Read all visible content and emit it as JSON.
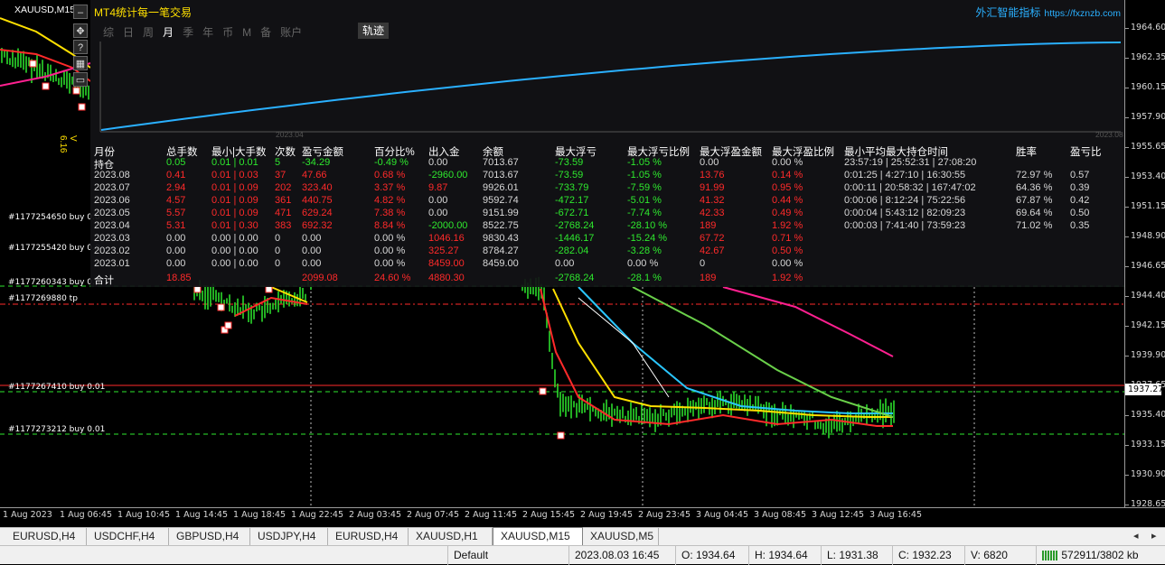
{
  "symbol_label": "XAUUSD,M15",
  "indicator_label": "V 6.16",
  "panel": {
    "title": "MT4统计每一笔交易",
    "brand": "外汇智能指标",
    "brand_url": "https://fxznzb.com",
    "periods": [
      "综",
      "日",
      "周",
      "月",
      "季",
      "年",
      "币",
      "M",
      "备",
      "账户"
    ],
    "active_period": "月",
    "traj_button": "轨迹",
    "mini_chart": {
      "x_start_label": "2023.04",
      "x_end_label": "2023.08"
    },
    "headers": [
      "月份",
      "总手数",
      "最小|大手数",
      "次数",
      "盈亏金额",
      "百分比%",
      "出入金",
      "余额",
      "最大浮亏",
      "最大浮亏比例",
      "最大浮盈金额",
      "最大浮盈比例",
      "最小平均最大持仓时间",
      "胜率",
      "盈亏比"
    ],
    "position_row": [
      "持仓",
      "0.05",
      "0.01 | 0.01",
      "5",
      "-34.29",
      "-0.49 %",
      "0.00",
      "7013.67",
      "-73.59",
      "-1.05 %",
      "0.00",
      "0.00 %",
      "23:57:19 | 25:52:31 | 27:08:20",
      "",
      ""
    ],
    "rows": [
      [
        "2023.08",
        "0.41",
        "0.01 | 0.03",
        "37",
        "47.66",
        "0.68 %",
        "-2960.00",
        "7013.67",
        "-73.59",
        "-1.05 %",
        "13.76",
        "0.14 %",
        "0:01:25 | 4:27:10 | 16:30:55",
        "72.97 %",
        "0.57"
      ],
      [
        "2023.07",
        "2.94",
        "0.01 | 0.09",
        "202",
        "323.40",
        "3.37 %",
        "9.87",
        "9926.01",
        "-733.79",
        "-7.59 %",
        "91.99",
        "0.95 %",
        "0:00:11 | 20:58:32 | 167:47:02",
        "64.36 %",
        "0.39"
      ],
      [
        "2023.06",
        "4.57",
        "0.01 | 0.09",
        "361",
        "440.75",
        "4.82 %",
        "0.00",
        "9592.74",
        "-472.17",
        "-5.01 %",
        "41.32",
        "0.44 %",
        "0:00:06 | 8:12:24 | 75:22:56",
        "67.87 %",
        "0.42"
      ],
      [
        "2023.05",
        "5.57",
        "0.01 | 0.09",
        "471",
        "629.24",
        "7.38 %",
        "0.00",
        "9151.99",
        "-672.71",
        "-7.74 %",
        "42.33",
        "0.49 %",
        "0:00:04 | 5:43:12 | 82:09:23",
        "69.64 %",
        "0.50"
      ],
      [
        "2023.04",
        "5.31",
        "0.01 | 0.30",
        "383",
        "692.32",
        "8.84 %",
        "-2000.00",
        "8522.75",
        "-2768.24",
        "-28.10 %",
        "189",
        "1.92 %",
        "0:00:03 | 7:41:40 | 73:59:23",
        "71.02 %",
        "0.35"
      ],
      [
        "2023.03",
        "0.00",
        "0.00 | 0.00",
        "0",
        "0.00",
        "0.00 %",
        "1046.16",
        "9830.43",
        "-1446.17",
        "-15.24 %",
        "67.72",
        "0.71 %",
        "",
        "",
        ""
      ],
      [
        "2023.02",
        "0.00",
        "0.00 | 0.00",
        "0",
        "0.00",
        "0.00 %",
        "325.27",
        "8784.27",
        "-282.04",
        "-3.28 %",
        "42.67",
        "0.50 %",
        "",
        "",
        ""
      ],
      [
        "2023.01",
        "0.00",
        "0.00 | 0.00",
        "0",
        "0.00",
        "0.00 %",
        "8459.00",
        "8459.00",
        "0.00",
        "0.00 %",
        "0",
        "0.00 %",
        "",
        "",
        ""
      ]
    ],
    "total_row": [
      "合计",
      "18.85",
      "",
      "",
      "2099.08",
      "24.60 %",
      "4880.30",
      "",
      "-2768.24",
      "-28.1 %",
      "189",
      "1.92 %",
      "",
      "",
      ""
    ]
  },
  "order_labels": [
    "#1177254650 buy 0.0",
    "#1177255420 buy 0.0",
    "#1177260343 buy 0.0",
    "#1177269880 tp",
    "#1177267410 buy 0.01",
    "#1177273212 buy 0.01"
  ],
  "price_labels": [
    "1964.60",
    "1962.35",
    "1960.15",
    "1957.90",
    "1955.65",
    "1953.40",
    "1951.15",
    "1948.90",
    "1946.65",
    "1944.40",
    "1942.15",
    "1939.90",
    "1937.65",
    "1935.40",
    "1933.15",
    "1930.90",
    "1928.65"
  ],
  "current_price": "1937.27",
  "time_labels": [
    "1 Aug 2023",
    "1 Aug 06:45",
    "1 Aug 10:45",
    "1 Aug 14:45",
    "1 Aug 18:45",
    "1 Aug 22:45",
    "2 Aug 03:45",
    "2 Aug 07:45",
    "2 Aug 11:45",
    "2 Aug 15:45",
    "2 Aug 19:45",
    "2 Aug 23:45",
    "3 Aug 04:45",
    "3 Aug 08:45",
    "3 Aug 12:45",
    "3 Aug 16:45"
  ],
  "tabs": [
    "EURUSD,H4",
    "USDCHF,H4",
    "GBPUSD,H4",
    "USDJPY,H4",
    "EURUSD,H4",
    "XAUUSD,H1",
    "XAUUSD,M15",
    "XAUUSD,M5"
  ],
  "active_tab": "XAUUSD,M15",
  "tabs_nav": [
    "◂",
    "▸"
  ],
  "status": {
    "profile": "Default",
    "datetime": "2023.08.03 16:45",
    "open": "O: 1934.64",
    "high": "H: 1934.64",
    "low": "L: 1931.38",
    "close": "C: 1932.23",
    "volume": "V: 6820",
    "traffic": "572911/3802 kb"
  },
  "colors": {
    "positive": "#2ee82e",
    "negative": "#ff2a2a",
    "neutral": "#d8d8d8",
    "accent_blue": "#2ab0ff",
    "title_yellow": "#ffe000"
  }
}
